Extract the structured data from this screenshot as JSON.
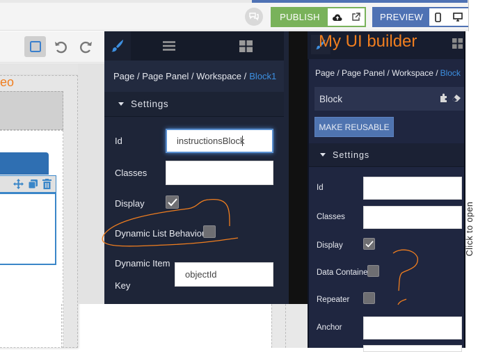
{
  "topbar": {
    "chat_icon": "chat-bubbles-icon",
    "publish": {
      "label": "PUBLISH",
      "icons": [
        "cloud-upload-icon",
        "external-link-icon"
      ],
      "color": "#79b25a"
    },
    "preview": {
      "label": "PREVIEW",
      "icons": [
        "mobile-icon",
        "desktop-icon"
      ],
      "color": "#4f72b4"
    }
  },
  "canvas": {
    "toolbar": {
      "select_icon": "square-select-icon",
      "undo_icon": "undo-icon",
      "redo_icon": "redo-icon"
    },
    "page_title_fragment": "eo",
    "block_toolbar_icons": [
      "move-icon",
      "copy-icon",
      "trash-icon"
    ]
  },
  "panel_left": {
    "tabs": [
      {
        "name": "style",
        "icon": "paintbrush-icon",
        "active": true
      },
      {
        "name": "layers",
        "icon": "hamburger-menu-icon",
        "active": false
      },
      {
        "name": "blocks",
        "icon": "grid-icon",
        "active": false
      }
    ],
    "breadcrumb": {
      "path": "Page / Page Panel / Workspace /",
      "current": "Block1"
    },
    "section_title": "Settings",
    "fields": {
      "id": {
        "label": "Id",
        "value": "instructionsBlock"
      },
      "classes": {
        "label": "Classes",
        "value": ""
      },
      "display": {
        "label": "Display",
        "checked": true
      },
      "dynamic_list": {
        "label": "Dynamic List Behaviour",
        "checked": false
      },
      "dynamic_item_key": {
        "label_line1": "Dynamic Item",
        "label_line2": "Key",
        "value": "objectId"
      }
    }
  },
  "panel_right": {
    "title": "My UI builder",
    "breadcrumb": {
      "path": "Page / Page Panel / Workspace /",
      "current": "Block"
    },
    "block_name": "Block",
    "block_icons": [
      "puzzle-icon",
      "eraser-icon"
    ],
    "make_reusable_label": "MAKE REUSABLE",
    "section_title": "Settings",
    "fields": {
      "id": {
        "label": "Id",
        "value": ""
      },
      "classes": {
        "label": "Classes",
        "value": ""
      },
      "display": {
        "label": "Display",
        "checked": true
      },
      "data_container": {
        "label": "Data Container",
        "checked": false
      },
      "repeater": {
        "label": "Repeater",
        "checked": false
      },
      "anchor": {
        "label": "Anchor",
        "value": ""
      }
    }
  },
  "side_tab": {
    "label": "Click to open"
  },
  "annotations": {
    "color": "#f07e1f"
  }
}
